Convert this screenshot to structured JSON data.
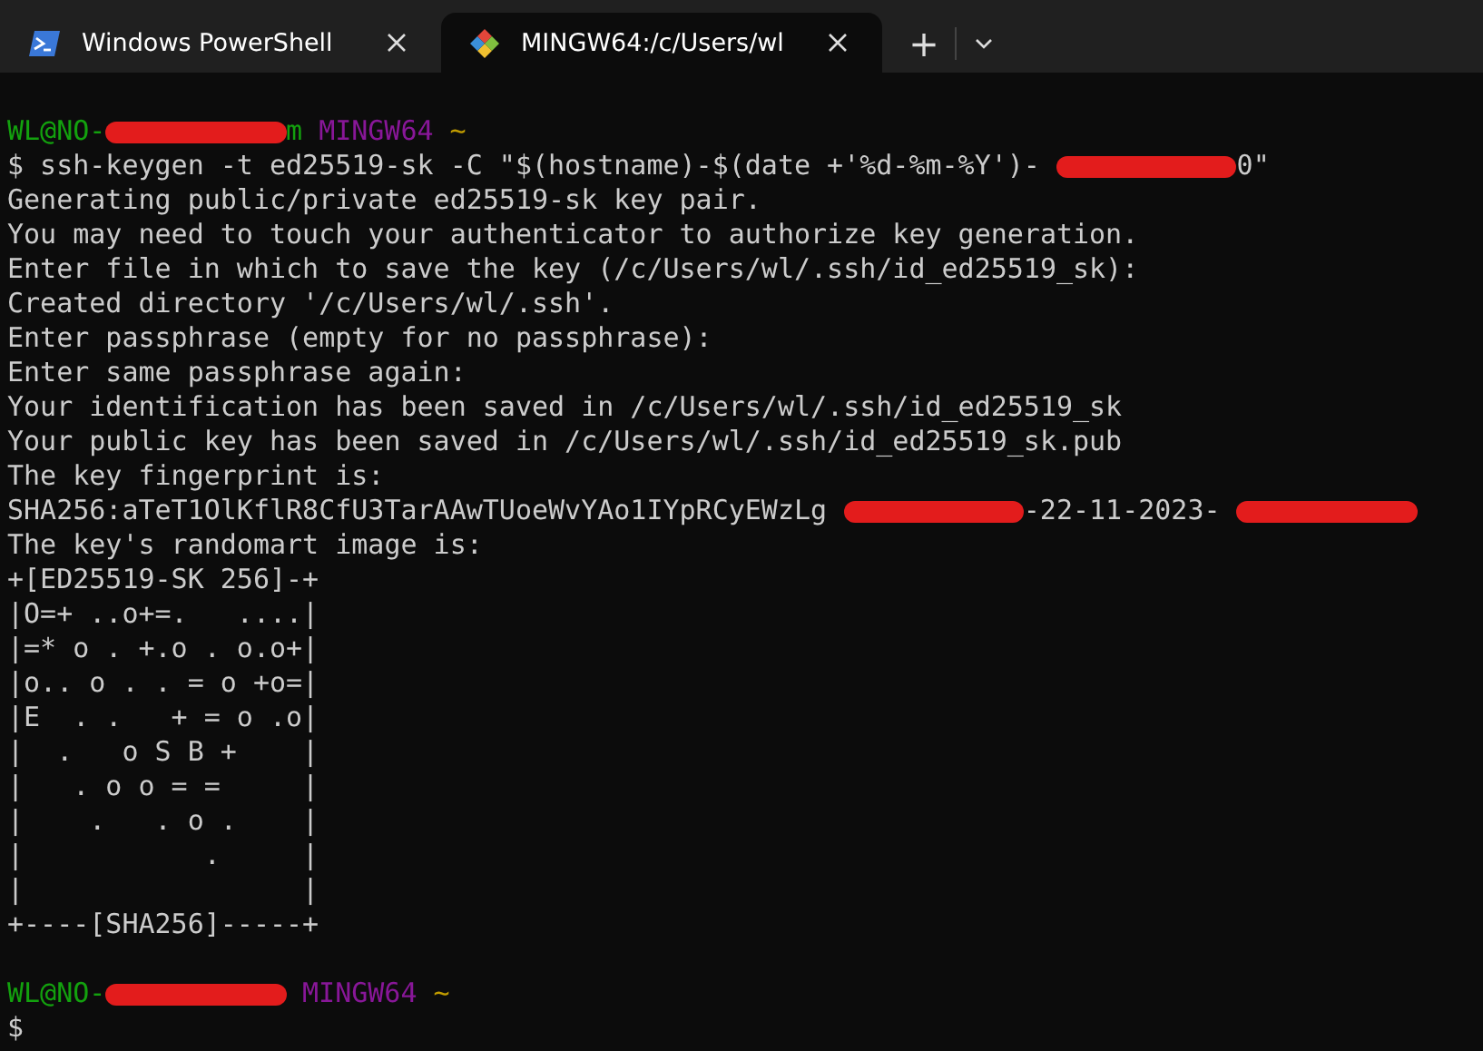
{
  "tabs": [
    {
      "label": "Windows PowerShell",
      "selected": false
    },
    {
      "label": "MINGW64:/c/Users/wl",
      "selected": true
    }
  ],
  "tab_actions": {
    "new_tab": "+"
  },
  "terminal": {
    "lines": [
      {
        "kind": "output",
        "segments": [
          {
            "kind": "user",
            "text": "WL@NO-"
          },
          {
            "kind": "redacted"
          },
          {
            "kind": "user",
            "text": "m"
          },
          {
            "kind": "shell",
            "text": "MINGW64"
          },
          {
            "kind": "path",
            "text": "~"
          }
        ]
      },
      {
        "kind": "output",
        "segments": [
          {
            "kind": "text",
            "text": "$ ssh-keygen -t ed25519-sk -C \"$(hostname)-$(date +'%d-%m-%Y')-"
          },
          {
            "kind": "redacted"
          },
          {
            "kind": "text",
            "text": "0\""
          }
        ]
      },
      {
        "kind": "output",
        "segments": [
          {
            "kind": "text",
            "text": "Generating public/private ed25519-sk key pair."
          }
        ]
      },
      {
        "kind": "output",
        "segments": [
          {
            "kind": "text",
            "text": "You may need to touch your authenticator to authorize key generation."
          }
        ]
      },
      {
        "kind": "output",
        "segments": [
          {
            "kind": "text",
            "text": "Enter file in which to save the key (/c/Users/wl/.ssh/id_ed25519_sk):"
          }
        ]
      },
      {
        "kind": "output",
        "segments": [
          {
            "kind": "text",
            "text": "Created directory '/c/Users/wl/.ssh'."
          }
        ]
      },
      {
        "kind": "output",
        "segments": [
          {
            "kind": "text",
            "text": "Enter passphrase (empty for no passphrase):"
          }
        ]
      },
      {
        "kind": "output",
        "segments": [
          {
            "kind": "text",
            "text": "Enter same passphrase again:"
          }
        ]
      },
      {
        "kind": "output",
        "segments": [
          {
            "kind": "text",
            "text": "Your identification has been saved in /c/Users/wl/.ssh/id_ed25519_sk"
          }
        ]
      },
      {
        "kind": "output",
        "segments": [
          {
            "kind": "text",
            "text": "Your public key has been saved in /c/Users/wl/.ssh/id_ed25519_sk.pub"
          }
        ]
      },
      {
        "kind": "output",
        "segments": [
          {
            "kind": "text",
            "text": "The key fingerprint is:"
          }
        ]
      },
      {
        "kind": "output",
        "segments": [
          {
            "kind": "text",
            "text": "SHA256:aTeT1OlKflR8CfU3TarAAwTUoeWvYAo1IYpRCyEWzLg"
          },
          {
            "kind": "redacted"
          },
          {
            "kind": "text",
            "text": "-22-11-2023-"
          },
          {
            "kind": "redacted"
          }
        ]
      },
      {
        "kind": "output",
        "segments": [
          {
            "kind": "text",
            "text": "The key's randomart image is:"
          }
        ]
      },
      {
        "kind": "output",
        "segments": [
          {
            "kind": "text",
            "text": "+[ED25519-SK 256]-+"
          }
        ]
      },
      {
        "kind": "output",
        "segments": [
          {
            "kind": "text",
            "text": "|O=+ ..o+=.   ....|"
          }
        ]
      },
      {
        "kind": "output",
        "segments": [
          {
            "kind": "text",
            "text": "|=* o . +.o . o.o+|"
          }
        ]
      },
      {
        "kind": "output",
        "segments": [
          {
            "kind": "text",
            "text": "|o.. o . . = o +o=|"
          }
        ]
      },
      {
        "kind": "output",
        "segments": [
          {
            "kind": "text",
            "text": "|E  . .   + = o .o|"
          }
        ]
      },
      {
        "kind": "output",
        "segments": [
          {
            "kind": "text",
            "text": "|  .   o S B +    |"
          }
        ]
      },
      {
        "kind": "output",
        "segments": [
          {
            "kind": "text",
            "text": "|   . o o = =     |"
          }
        ]
      },
      {
        "kind": "output",
        "segments": [
          {
            "kind": "text",
            "text": "|    .   . o .    |"
          }
        ]
      },
      {
        "kind": "output",
        "segments": [
          {
            "kind": "text",
            "text": "|           .     |"
          }
        ]
      },
      {
        "kind": "output",
        "segments": [
          {
            "kind": "text",
            "text": "|                 |"
          }
        ]
      },
      {
        "kind": "output",
        "segments": [
          {
            "kind": "text",
            "text": "+----[SHA256]-----+"
          }
        ]
      },
      {
        "kind": "blank"
      },
      {
        "kind": "output",
        "segments": [
          {
            "kind": "user",
            "text": "WL@NO-"
          },
          {
            "kind": "redacted"
          },
          {
            "kind": "shell",
            "text": "MINGW64"
          },
          {
            "kind": "path",
            "text": "~"
          }
        ]
      },
      {
        "kind": "output",
        "segments": [
          {
            "kind": "text",
            "text": "$"
          }
        ]
      }
    ]
  }
}
